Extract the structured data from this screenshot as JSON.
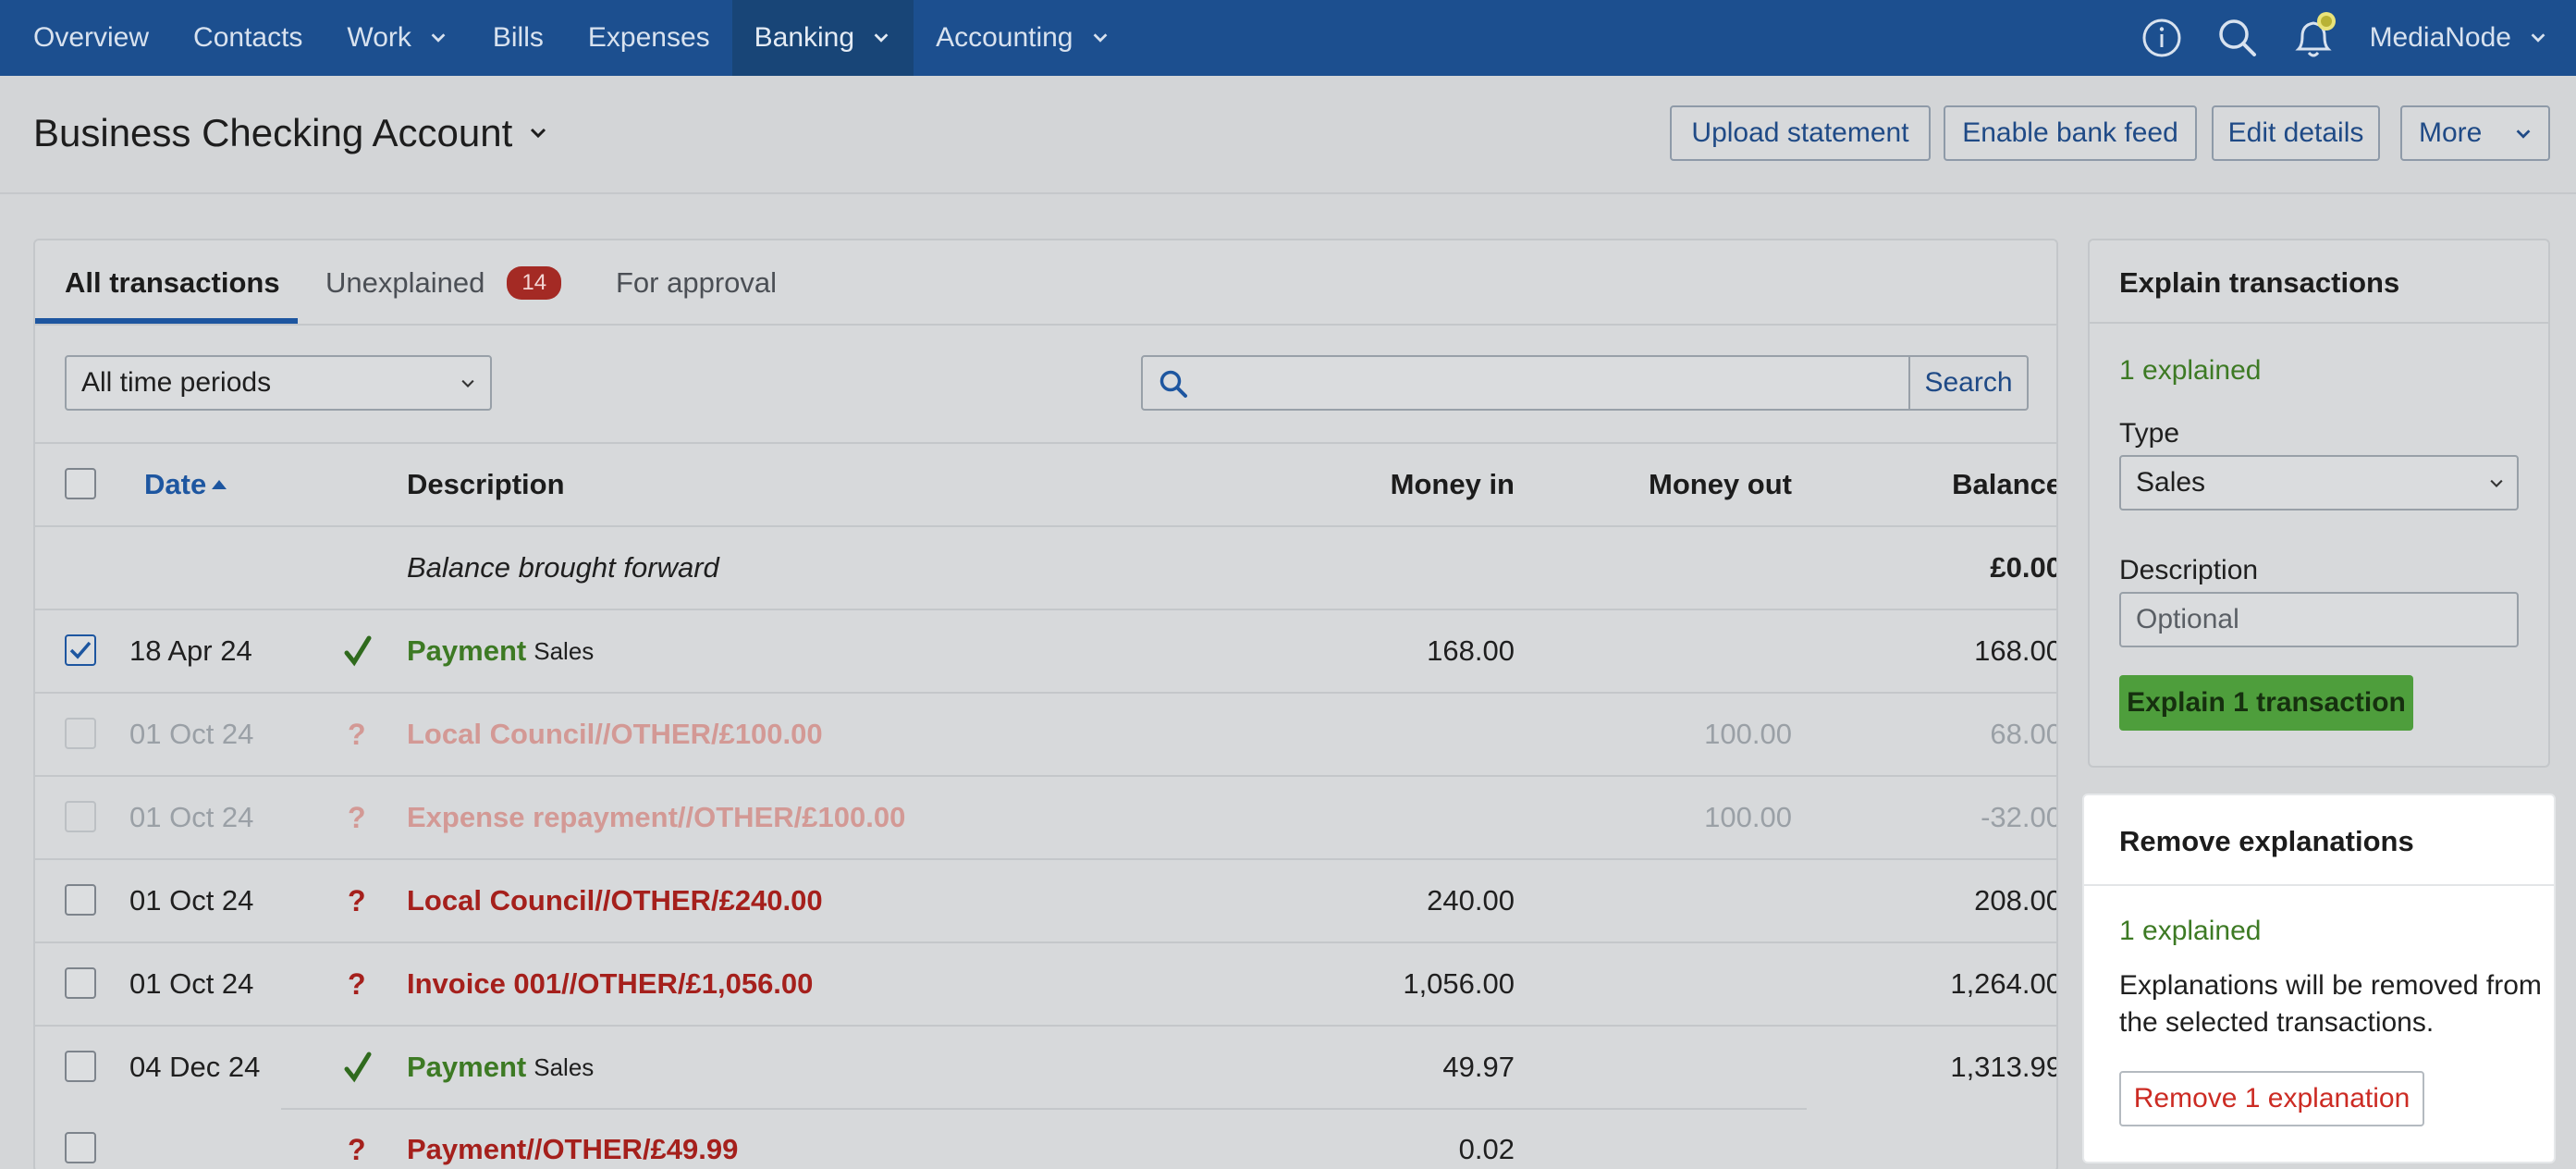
{
  "nav": {
    "items": [
      {
        "label": "Overview",
        "dropdown": false,
        "active": false
      },
      {
        "label": "Contacts",
        "dropdown": false,
        "active": false
      },
      {
        "label": "Work",
        "dropdown": true,
        "active": false
      },
      {
        "label": "Bills",
        "dropdown": false,
        "active": false
      },
      {
        "label": "Expenses",
        "dropdown": false,
        "active": false
      },
      {
        "label": "Banking",
        "dropdown": true,
        "active": true
      },
      {
        "label": "Accounting",
        "dropdown": true,
        "active": false
      }
    ],
    "org_name": "MediaNode",
    "icons": [
      "info-icon",
      "search-icon",
      "bell-icon"
    ]
  },
  "header": {
    "account_title": "Business Checking Account",
    "buttons": {
      "upload": "Upload statement",
      "bank_feed": "Enable bank feed",
      "edit": "Edit details",
      "more": "More"
    }
  },
  "tabs": {
    "all": "All transactions",
    "unexplained": "Unexplained",
    "unexplained_count": "14",
    "approval": "For approval"
  },
  "filters": {
    "period": "All time periods",
    "search_value": "",
    "search_button": "Search"
  },
  "table": {
    "headers": {
      "date": "Date",
      "description": "Description",
      "money_in": "Money in",
      "money_out": "Money out",
      "balance": "Balance"
    },
    "opening": {
      "label": "Balance brought forward",
      "balance": "£0.00"
    },
    "rows": [
      {
        "checked": true,
        "faded": false,
        "status": "explained",
        "date": "18 Apr 24",
        "desc": "Payment",
        "sub": "Sales",
        "money_in": "168.00",
        "money_out": "",
        "balance": "168.00"
      },
      {
        "checked": false,
        "faded": true,
        "status": "unexplained",
        "date": "01 Oct 24",
        "desc": "Local Council//OTHER/£100.00",
        "sub": "",
        "money_in": "",
        "money_out": "100.00",
        "balance": "68.00"
      },
      {
        "checked": false,
        "faded": true,
        "status": "unexplained",
        "date": "01 Oct 24",
        "desc": "Expense repayment//OTHER/£100.00",
        "sub": "",
        "money_in": "",
        "money_out": "100.00",
        "balance": "-32.00"
      },
      {
        "checked": false,
        "faded": false,
        "status": "unexplained",
        "date": "01 Oct 24",
        "desc": "Local Council//OTHER/£240.00",
        "sub": "",
        "money_in": "240.00",
        "money_out": "",
        "balance": "208.00"
      },
      {
        "checked": false,
        "faded": false,
        "status": "unexplained",
        "date": "01 Oct 24",
        "desc": "Invoice 001//OTHER/£1,056.00",
        "sub": "",
        "money_in": "1,056.00",
        "money_out": "",
        "balance": "1,264.00"
      },
      {
        "checked": false,
        "faded": false,
        "status": "explained",
        "date": "04 Dec 24",
        "desc": "Payment",
        "sub": "Sales",
        "money_in": "49.97",
        "money_out": "",
        "balance": "1,313.99"
      },
      {
        "checked": false,
        "faded": false,
        "status": "unexplained",
        "date": "",
        "desc": "Payment//OTHER/£49.99",
        "sub": "",
        "money_in": "0.02",
        "money_out": "",
        "balance": ""
      }
    ]
  },
  "explain_panel": {
    "title": "Explain transactions",
    "count": "1 explained",
    "type_label": "Type",
    "type_value": "Sales",
    "description_label": "Description",
    "description_placeholder": "Optional",
    "button": "Explain 1 transaction"
  },
  "remove_panel": {
    "title": "Remove explanations",
    "count": "1 explained",
    "text": "Explanations will be removed from the selected transactions.",
    "button": "Remove 1 explanation"
  },
  "colors": {
    "nav_bg": "#1c4f8f",
    "accent": "#1d56a0",
    "success": "#3d7a24",
    "danger": "#a5201c",
    "explain_button": "#4e9e3c"
  }
}
